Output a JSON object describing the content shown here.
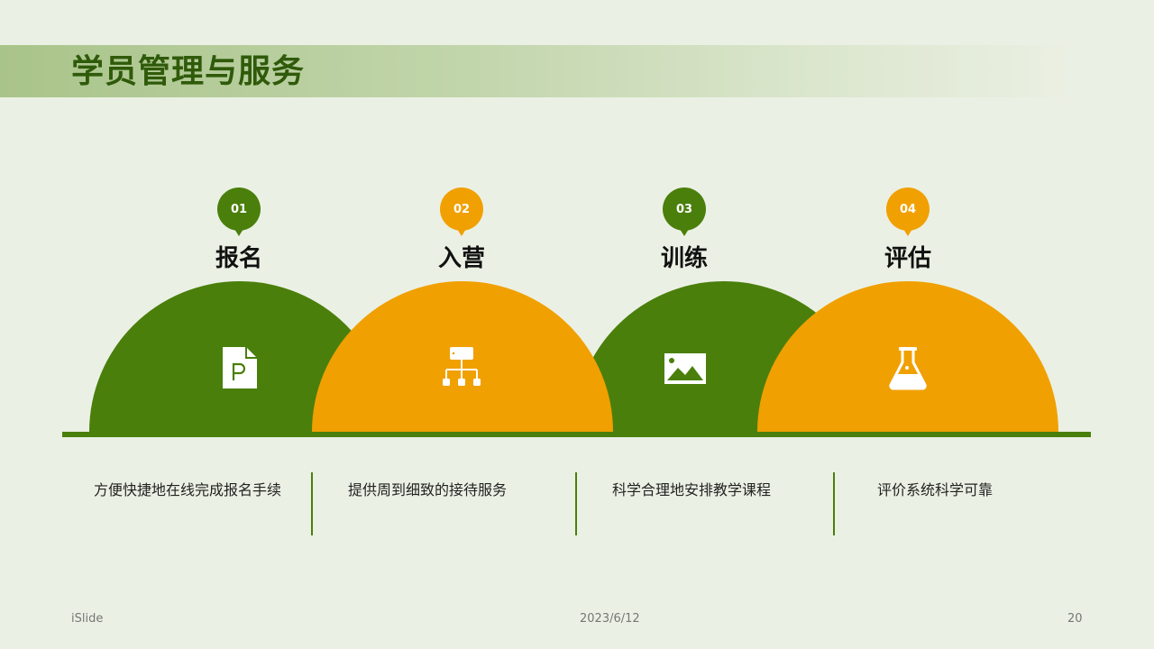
{
  "page_title": "学员管理与服务",
  "colors": {
    "green": "#4a7f0b",
    "orange": "#f0a000",
    "title": "#2f5a0a"
  },
  "steps": [
    {
      "num": "01",
      "title": "报名",
      "icon": "document-p-icon",
      "desc": "方便快捷地在线完成报名手续"
    },
    {
      "num": "02",
      "title": "入营",
      "icon": "hierarchy-icon",
      "desc": "提供周到细致的接待服务"
    },
    {
      "num": "03",
      "title": "训练",
      "icon": "image-icon",
      "desc": "科学合理地安排教学课程"
    },
    {
      "num": "04",
      "title": "评估",
      "icon": "flask-icon",
      "desc": "评价系统科学可靠"
    }
  ],
  "footer": {
    "brand": "iSlide",
    "date": "2023/6/12",
    "page": "20"
  }
}
